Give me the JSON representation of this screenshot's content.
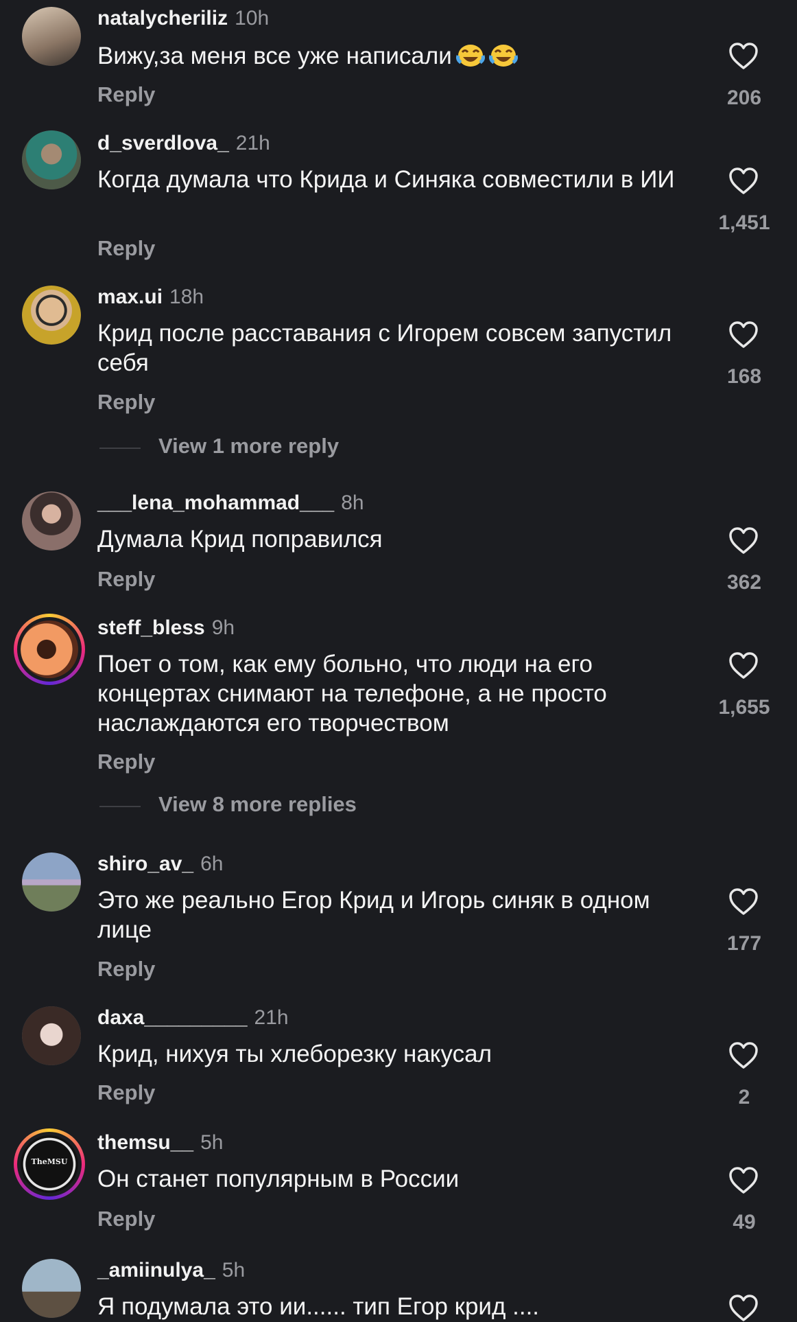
{
  "comments": [
    {
      "username": "natalycheriliz",
      "time": "10h",
      "text": "Вижу,за меня все уже написали",
      "emoji_count": 2,
      "reply": "Reply",
      "likes": "206",
      "avatar_colors": [
        "#c9b9a6",
        "#7b6a5c"
      ]
    },
    {
      "username": "d_sverdlova_",
      "time": "21h",
      "text": "Когда думала что Крида и Синяка совместили в ИИ",
      "reply": "Reply",
      "likes": "1,451",
      "avatar_colors": [
        "#5a6b55",
        "#2d7f74"
      ]
    },
    {
      "username": "max.ui",
      "time": "18h",
      "text": "Крид после расставания с Игорем совсем запустил себя",
      "reply": "Reply",
      "likes": "168",
      "avatar_colors": [
        "#d8b48f",
        "#c7a32a"
      ],
      "view_more": "View 1 more reply"
    },
    {
      "username": "___lena_mohammad___",
      "time": "8h",
      "text": "Думала Крид поправился",
      "reply": "Reply",
      "likes": "362",
      "avatar_colors": [
        "#8a6f6a",
        "#3b2e2d"
      ]
    },
    {
      "username": "steff_bless",
      "time": "9h",
      "text": "Поет о том, как ему больно, что люди на его концертах снимают на телефоне, а не просто наслаждаются его творчеством",
      "reply": "Reply",
      "likes": "1,655",
      "avatar_colors": [
        "#f29a63",
        "#5a2b1a"
      ],
      "story": true,
      "view_more": "View 8 more replies"
    },
    {
      "username": "shiro_av_",
      "time": "6h",
      "text": "Это же реально Егор Крид и Игорь синяк в одном лице",
      "reply": "Reply",
      "likes": "177",
      "avatar_colors": [
        "#8da4c6",
        "#6f7e5a"
      ]
    },
    {
      "username": "daxa_________",
      "time": "21h",
      "text": "Крид, нихуя ты хлеборезку накусал",
      "reply": "Reply",
      "likes": "2",
      "avatar_colors": [
        "#e9d6cf",
        "#3a2a26"
      ]
    },
    {
      "username": "themsu__",
      "time": "5h",
      "text": "Он станет популярным в России",
      "reply": "Reply",
      "likes": "49",
      "avatar_colors": [
        "#111111",
        "#2a2a2a"
      ],
      "story": true,
      "avatar_label": "TheMSU"
    },
    {
      "username": "_amiinulya_",
      "time": "5h",
      "text": "Я подумала это ии...... тип  Егор крид ....",
      "reply": "",
      "likes": "",
      "avatar_colors": [
        "#9fb6c8",
        "#5d5042"
      ]
    }
  ]
}
